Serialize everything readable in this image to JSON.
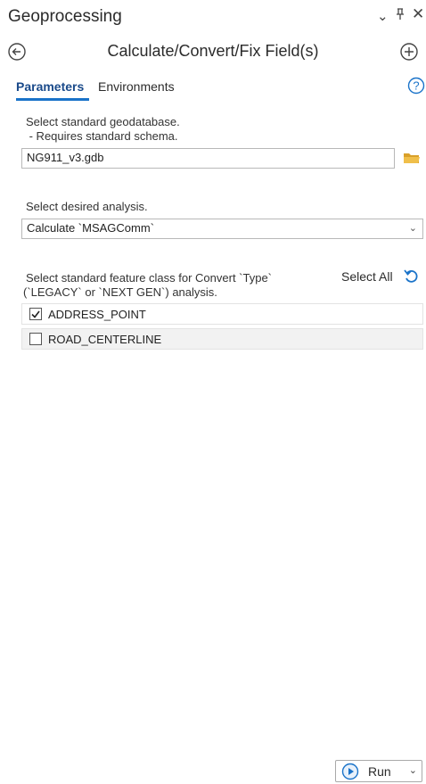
{
  "pane": {
    "title": "Geoprocessing"
  },
  "tool": {
    "title": "Calculate/Convert/Fix Field(s)"
  },
  "tabs": [
    {
      "label": "Parameters",
      "active": true
    },
    {
      "label": "Environments",
      "active": false
    }
  ],
  "params": {
    "gdb_label_line1": "Select standard geodatabase.",
    "gdb_label_line2": " - Requires standard schema.",
    "gdb_value": "NG911_v3.gdb",
    "analysis_label": "Select desired analysis.",
    "analysis_value": "Calculate `MSAGComm`",
    "fc_label_line1": "Select standard feature class for Convert `Type`",
    "fc_label_line2": "(`LEGACY` or `NEXT GEN`) analysis.",
    "select_all": "Select All",
    "feature_classes": [
      {
        "label": "ADDRESS_POINT",
        "checked": true
      },
      {
        "label": "ROAD_CENTERLINE",
        "checked": false
      }
    ]
  },
  "footer": {
    "run_label": "Run"
  },
  "colors": {
    "accent": "#1a73c9",
    "folder": "#e8b43a"
  }
}
